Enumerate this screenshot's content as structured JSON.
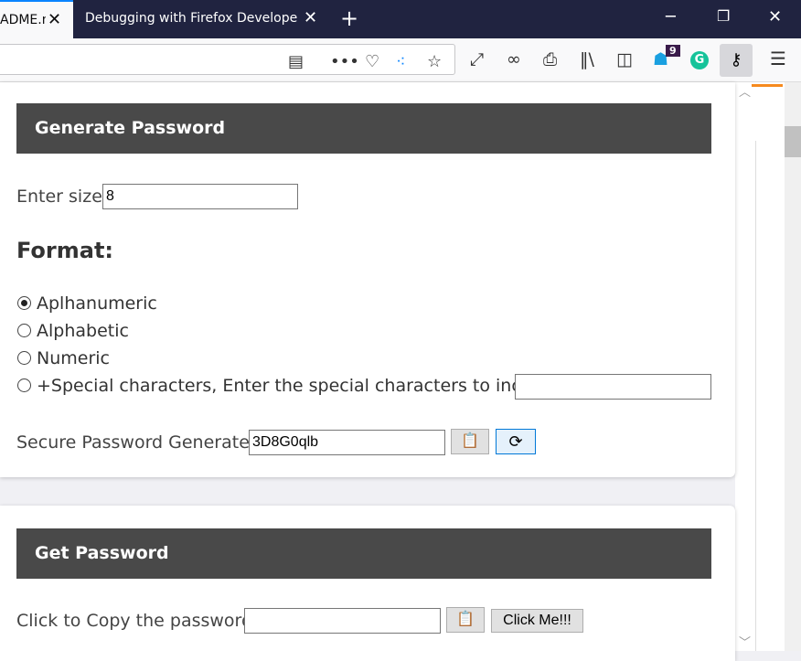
{
  "browser": {
    "tabs": [
      {
        "label": "ADME.m",
        "active": true
      },
      {
        "label": "Debugging with Firefox Developer",
        "active": false
      }
    ],
    "new_tab_icon": "plus-icon",
    "window_controls": [
      "minimize-icon",
      "restore-icon",
      "close-icon"
    ],
    "toolbar_icons": [
      "reader-view-icon",
      "more-icon",
      "pocket-icon",
      "extension-icon",
      "bookmark-star-icon",
      "fullscreen-icon",
      "mask-icon",
      "print-icon",
      "library-icon",
      "sidebar-icon",
      "ghostery-icon",
      "grammarly-icon",
      "key-icon",
      "hamburger-menu-icon"
    ],
    "badge_count": "9",
    "grammarly_label": "G"
  },
  "generate": {
    "header": "Generate Password",
    "size_label": "Enter size:",
    "size_value": "8",
    "format_heading": "Format:",
    "options": [
      {
        "label": "Aplhanumeric",
        "checked": true
      },
      {
        "label": "Alphabetic",
        "checked": false
      },
      {
        "label": "Numeric",
        "checked": false
      },
      {
        "label": "+Special characters, Enter the special characters to include:",
        "checked": false
      }
    ],
    "special_value": "",
    "generated_label": "Secure Password Generated:",
    "generated_value": "3D8G0qlb"
  },
  "get": {
    "header": "Get Password",
    "copy_label": "Click to Copy the password:",
    "copy_value": "",
    "click_button": "Click Me!!!"
  },
  "colors": {
    "header_bg": "#494949",
    "tabbar_bg": "#202340",
    "accent": "#0a84ff"
  }
}
